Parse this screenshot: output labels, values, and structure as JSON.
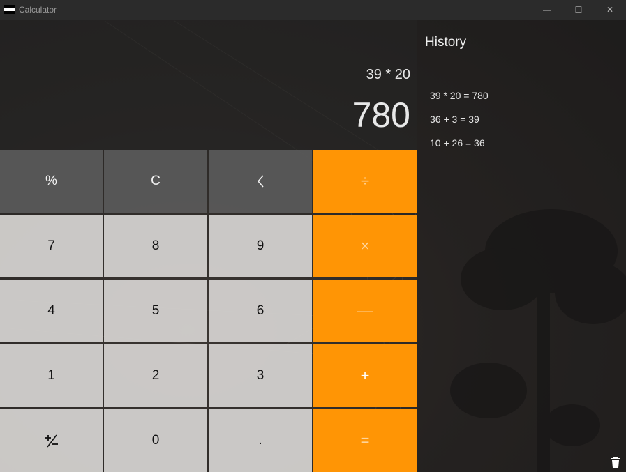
{
  "window": {
    "title": "Calculator",
    "controls": {
      "minimize": "—",
      "maximize": "☐",
      "close": "✕"
    }
  },
  "display": {
    "expression": "39 * 20",
    "result": "780"
  },
  "keypad": {
    "percent": "%",
    "clear": "C",
    "backspace": "〈",
    "divide": "÷",
    "seven": "7",
    "eight": "8",
    "nine": "9",
    "multiply": "×",
    "four": "4",
    "five": "5",
    "six": "6",
    "subtract": "—",
    "one": "1",
    "two": "2",
    "three": "3",
    "add": "+",
    "negate": "⁺∕₋",
    "zero": "0",
    "decimal": ".",
    "equals": "="
  },
  "history": {
    "title": "History",
    "items": [
      "39 * 20 = 780",
      "36 + 3 = 39",
      "10 + 26 = 36"
    ],
    "clear_icon": "trash-icon"
  },
  "colors": {
    "operator": "#ff9505",
    "function_key": "#5a5a5a",
    "number_key": "#d6d4d2",
    "title_bar": "#2b2b2b"
  }
}
